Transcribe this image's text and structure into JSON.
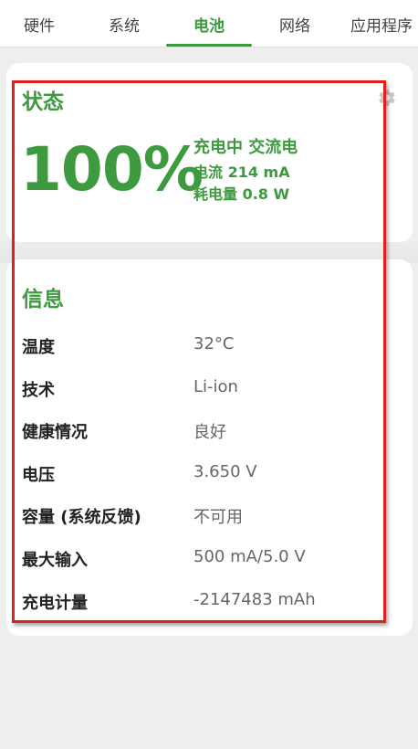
{
  "tabs": [
    {
      "label": "硬件"
    },
    {
      "label": "系统"
    },
    {
      "label": "电池"
    },
    {
      "label": "网络"
    },
    {
      "label": "应用程序"
    }
  ],
  "active_tab": "电池",
  "status": {
    "title": "状态",
    "percent": "100%",
    "charging": "充电中 交流电",
    "current": "电流 214 mA",
    "power": "耗电量 0.8 W",
    "settings_icon": "gear-icon"
  },
  "info": {
    "title": "信息",
    "rows": [
      {
        "key": "温度",
        "value": "32°C"
      },
      {
        "key": "技术",
        "value": "Li-ion"
      },
      {
        "key": "健康情况",
        "value": "良好"
      },
      {
        "key": "电压",
        "value": "3.650 V"
      },
      {
        "key": "容量 (系统反馈)",
        "value": "不可用"
      },
      {
        "key": "最大输入",
        "value": "500 mA/5.0 V"
      },
      {
        "key": "充电计量",
        "value": "-2147483 mAh"
      }
    ]
  },
  "colors": {
    "accent": "#3e9a3e",
    "highlight": "#e02020"
  }
}
